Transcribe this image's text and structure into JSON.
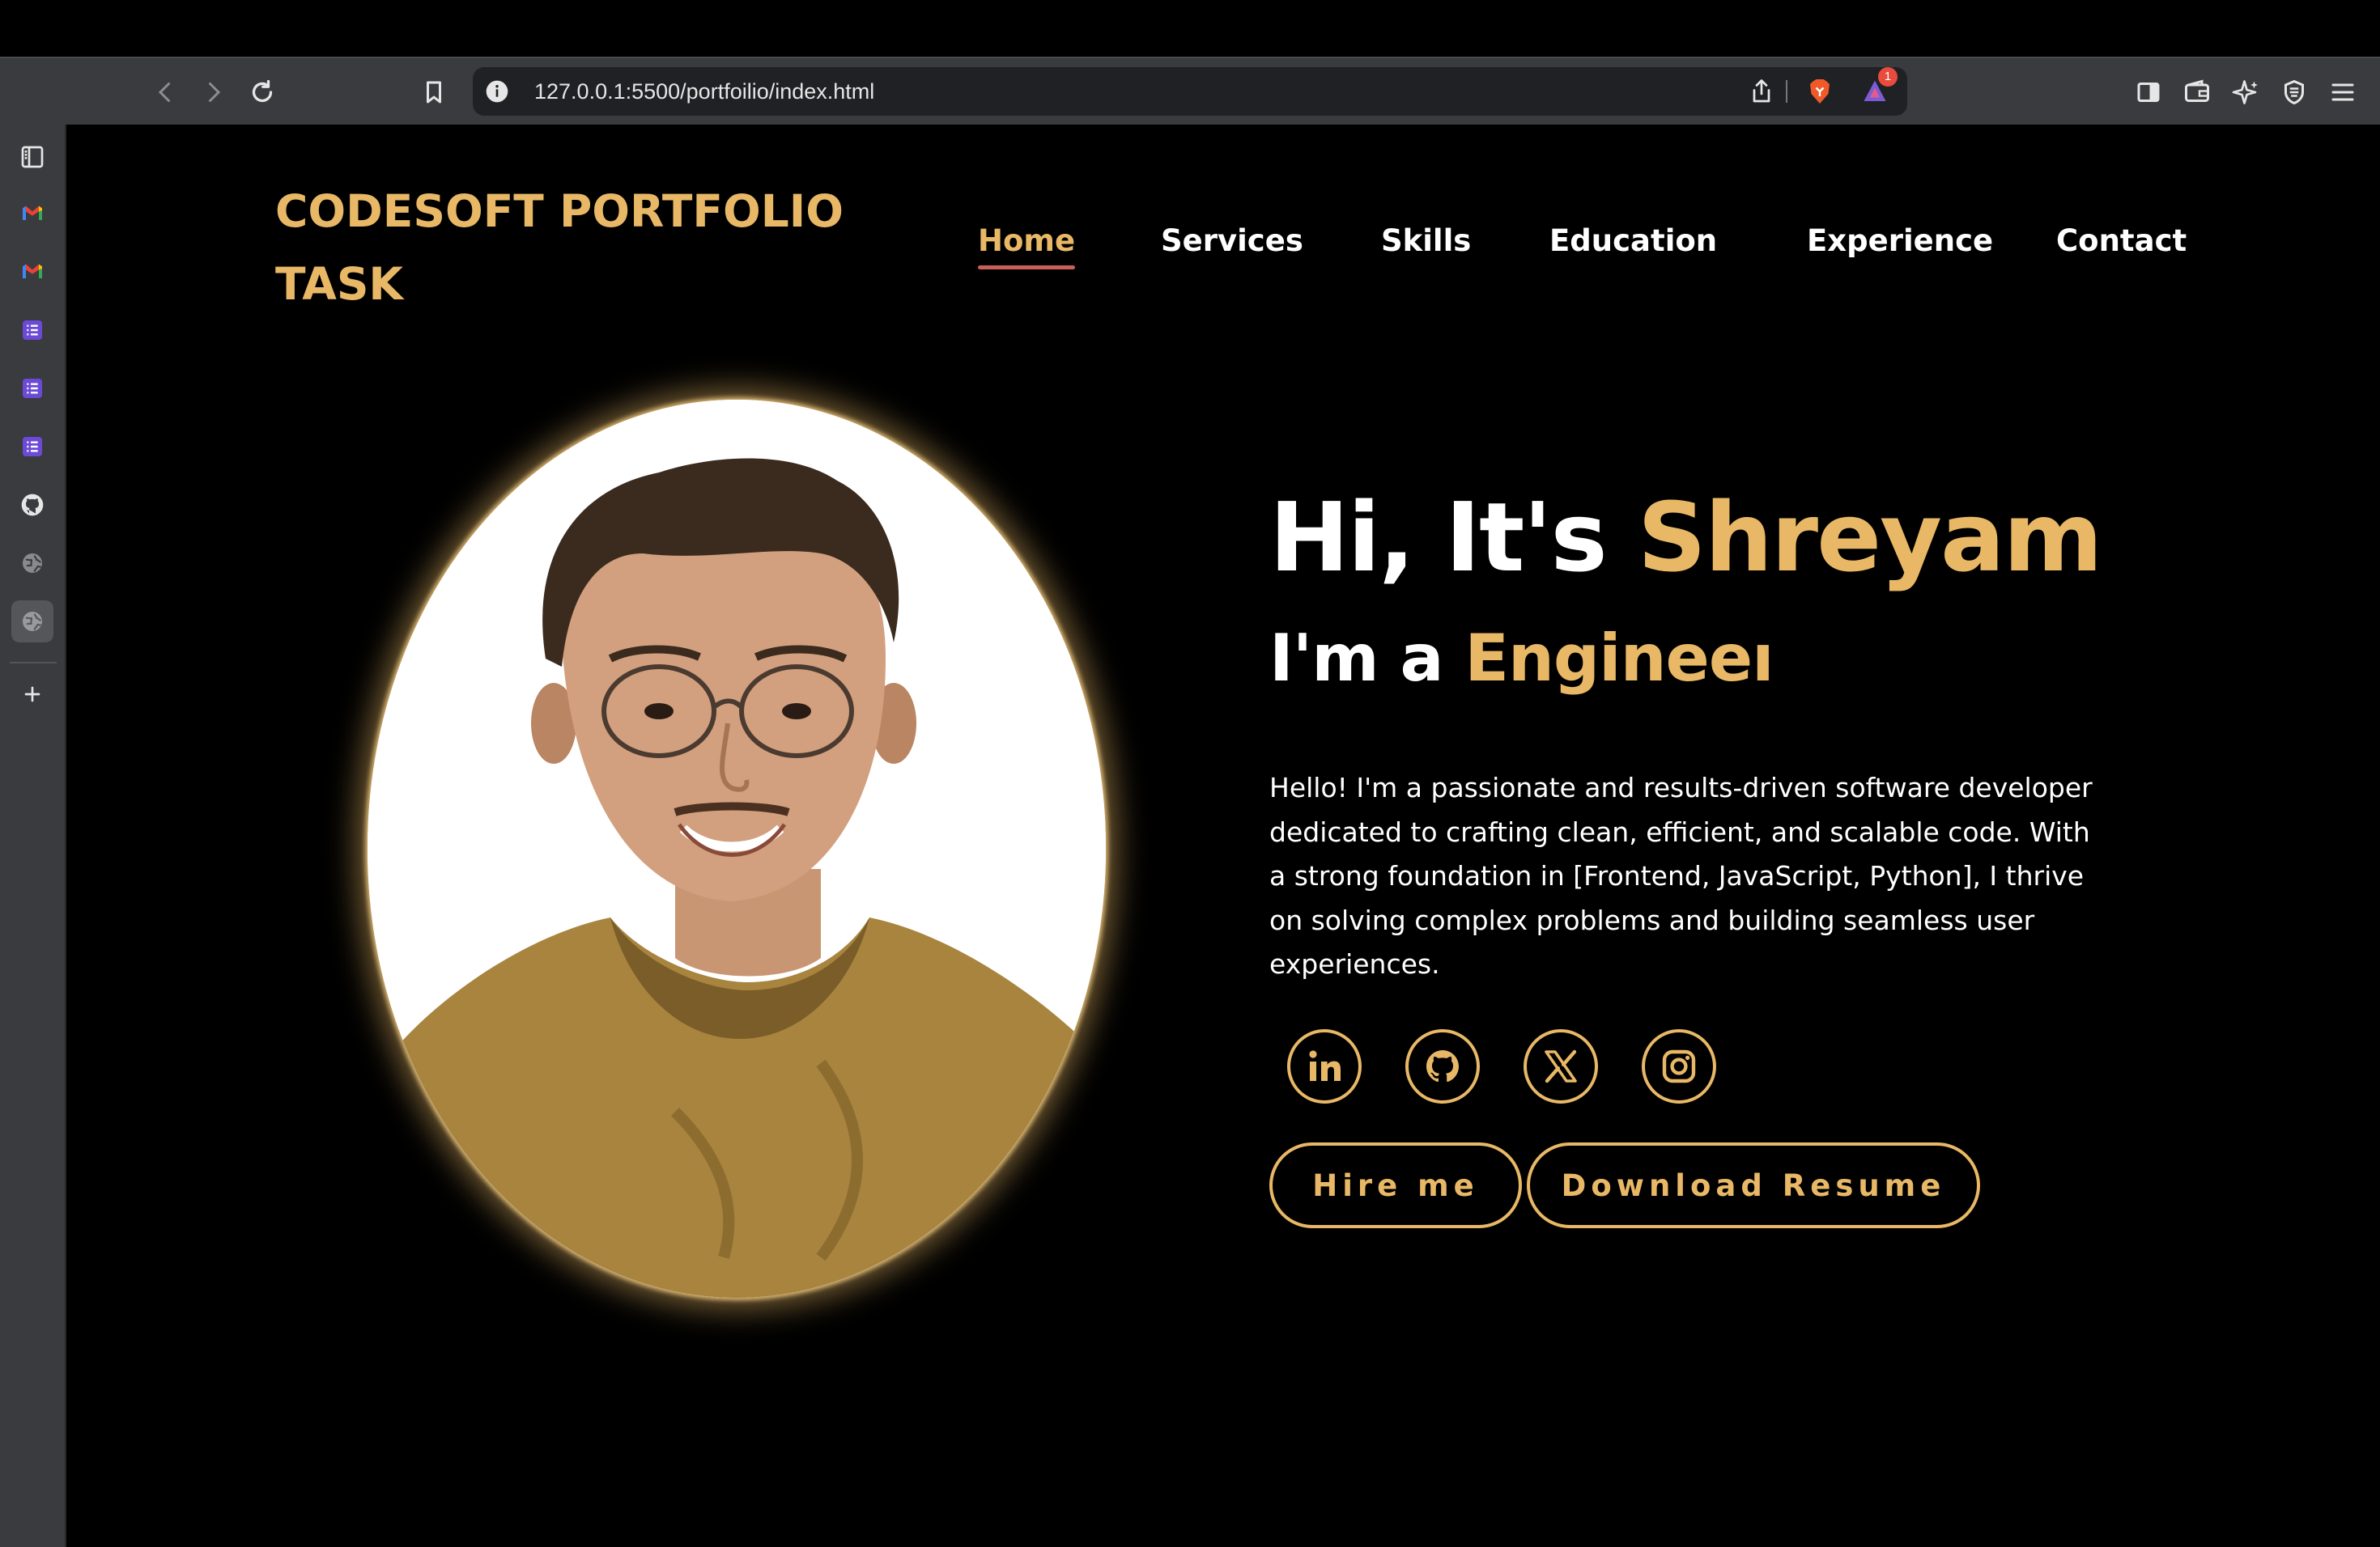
{
  "browser": {
    "url": "127.0.0.1:5500/portfoilio/index.html",
    "notification_count": "1"
  },
  "page": {
    "logo": "CODESOFT PORTFOLIO TASK",
    "nav": [
      "Home",
      "Services",
      "Skills",
      "Education",
      "Experience",
      "Contact"
    ],
    "active_nav": "Home",
    "greeting_prefix": "Hi, It's",
    "greeting_name": "Shreyam",
    "role_prefix": "I'm a",
    "role_value": "Engineeı",
    "bio": "Hello! I'm a passionate and results-driven software developer dedicated to crafting clean, efficient, and scalable code. With a strong foundation in [Frontend, JavaScript, Python], I thrive on solving complex problems and building seamless user experiences.",
    "social_links": [
      "linkedin-icon",
      "github-icon",
      "x-icon",
      "instagram-icon"
    ],
    "buttons": {
      "hire": "Hire me",
      "resume": "Download Resume"
    }
  },
  "colors": {
    "accent": "#e8b866",
    "background": "#000000",
    "nav_underline": "#c8605a"
  }
}
